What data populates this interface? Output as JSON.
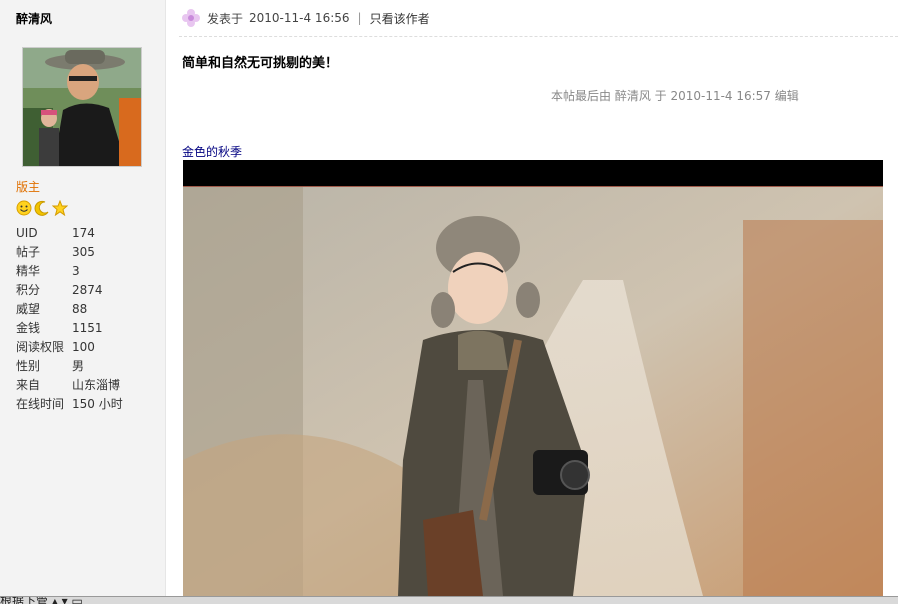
{
  "sidebar": {
    "username": "醉清风",
    "role": "版主",
    "medals": [
      "smile-medal",
      "moon-medal",
      "star-medal"
    ],
    "stats": [
      {
        "label": "UID",
        "value": "174"
      },
      {
        "label": "帖子",
        "value": "305"
      },
      {
        "label": "精华",
        "value": "3"
      },
      {
        "label": "积分",
        "value": "2874"
      },
      {
        "label": "威望",
        "value": "88"
      },
      {
        "label": "金钱",
        "value": "1151"
      },
      {
        "label": "阅读权限",
        "value": "100"
      },
      {
        "label": "性别",
        "value": "男"
      },
      {
        "label": "来自",
        "value": "山东淄博"
      },
      {
        "label": "在线时间",
        "value": "150 小时"
      }
    ]
  },
  "post": {
    "posted_prefix": "发表于",
    "posted_time": "2010-11-4 16:56",
    "separator": "|",
    "author_only": "只看该作者",
    "title": "简单和自然无可挑剔的美！",
    "edit_note": "本帖最后由 醉清风 于 2010-11-4 16:57 编辑",
    "image_caption": "金色的秋季"
  },
  "bottom": {
    "text": "根据下管 ▴ ▾ ▭"
  }
}
